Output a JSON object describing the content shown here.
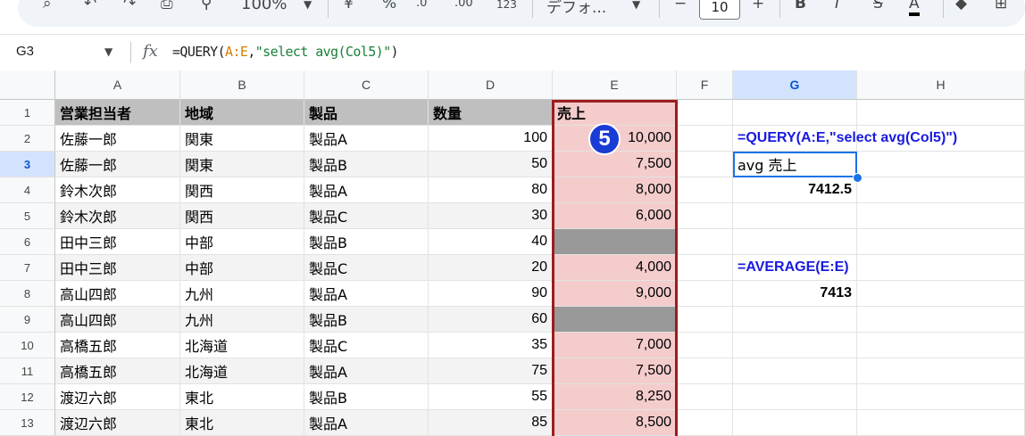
{
  "toolbar": {
    "zoom": "100%",
    "currency_symbol": "¥",
    "percent_symbol": "%",
    "decimal_decrease": ".0",
    "decimal_increase": ".00",
    "number_format": "123",
    "font_name": "デフォ...",
    "font_size": "10",
    "minus": "−",
    "plus": "+",
    "bold": "B",
    "italic": "I",
    "strike": "S",
    "text_color": "A"
  },
  "formula_bar": {
    "name_box": "G3",
    "fx": "fx",
    "formula_prefix": "=QUERY(",
    "formula_ref": "A:E",
    "formula_comma": ",",
    "formula_string": "\"select avg(Col5)\"",
    "formula_suffix": ")"
  },
  "columns": [
    "A",
    "B",
    "C",
    "D",
    "E",
    "F",
    "G",
    "H"
  ],
  "rows": [
    "1",
    "2",
    "3",
    "4",
    "5",
    "6",
    "7",
    "8",
    "9",
    "10",
    "11",
    "12",
    "13"
  ],
  "table": {
    "headers": [
      "営業担当者",
      "地域",
      "製品",
      "数量",
      "売上"
    ],
    "data": [
      [
        "佐藤一郎",
        "関東",
        "製品A",
        "100",
        "10,000"
      ],
      [
        "佐藤一郎",
        "関東",
        "製品B",
        "50",
        "7,500"
      ],
      [
        "鈴木次郎",
        "関西",
        "製品A",
        "80",
        "8,000"
      ],
      [
        "鈴木次郎",
        "関西",
        "製品C",
        "30",
        "6,000"
      ],
      [
        "田中三郎",
        "中部",
        "製品B",
        "40",
        ""
      ],
      [
        "田中三郎",
        "中部",
        "製品C",
        "20",
        "4,000"
      ],
      [
        "高山四郎",
        "九州",
        "製品A",
        "90",
        "9,000"
      ],
      [
        "高山四郎",
        "九州",
        "製品B",
        "60",
        ""
      ],
      [
        "高橋五郎",
        "北海道",
        "製品C",
        "35",
        "7,000"
      ],
      [
        "高橋五郎",
        "北海道",
        "製品A",
        "75",
        "7,500"
      ],
      [
        "渡辺六郎",
        "東北",
        "製品B",
        "55",
        "8,250"
      ],
      [
        "渡辺六郎",
        "東北",
        "製品A",
        "85",
        "8,500"
      ]
    ]
  },
  "side_cells": {
    "g2": "=QUERY(A:E,\"select avg(Col5)\")",
    "g3": "avg 売上",
    "g4": "7412.5",
    "g7": "=AVERAGE(E:E)",
    "g8": "7413"
  },
  "badge": "5",
  "colors": {
    "header_gray": "#bfbfbf",
    "sales_highlight": "#f4cccc",
    "blank_cell": "#999999",
    "formula_blue": "#1a1ae0",
    "badge_blue": "#1a3cd4",
    "selection": "#1a73e8"
  }
}
